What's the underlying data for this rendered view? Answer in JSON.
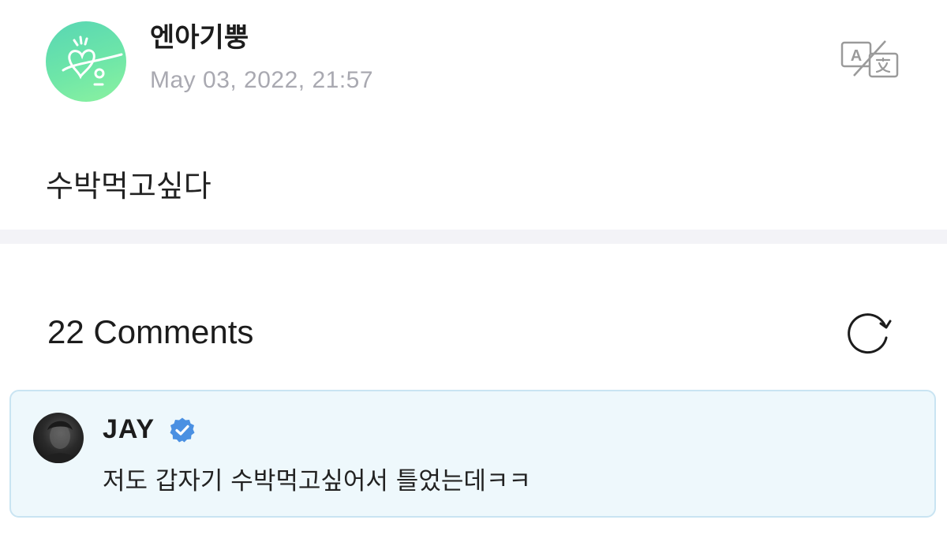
{
  "post": {
    "author": "엔아기뿡",
    "date": "May 03, 2022, 21:57",
    "body": "수박먹고싶다",
    "translate_icon": "translate-icon"
  },
  "comments": {
    "count_label": "22 Comments",
    "refresh_icon": "refresh-icon",
    "items": [
      {
        "author": "JAY",
        "verified": true,
        "text": "저도 갑자기 수박먹고싶어서 틀었는데ㅋㅋ"
      }
    ]
  },
  "colors": {
    "date_text": "#a9a9b1",
    "divider": "#f3f3f7",
    "highlight_bg": "#eef8fc",
    "highlight_border": "#c9e4f2",
    "verified_blue": "#4a90e2",
    "avatar_green": "#6ee6a8"
  }
}
